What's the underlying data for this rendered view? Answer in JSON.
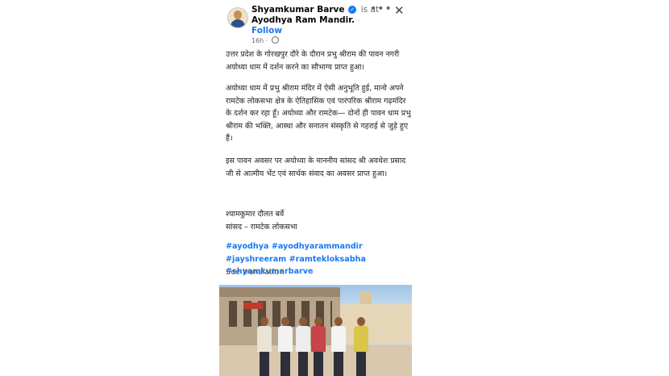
{
  "post": {
    "author": "Shyamkumar Barve",
    "verified_icon": "✓",
    "is_at": "is at",
    "place": "Ayodhya Ram Mandir.",
    "place_dot": "·",
    "follow": "Follow",
    "time": "16h",
    "time_dot": "·",
    "more_icon": "•••",
    "close_icon": "✕",
    "paragraphs": [
      "उत्तर प्रदेश के गोरखपुर दौरे के दौरान प्रभु श्रीराम की पावन नगरी अयोध्या धाम में दर्शन करने का सौभाग्य प्राप्त हुआ।",
      "अयोध्या धाम में प्रभु श्रीराम मंदिर में ऐसी अनुभूति हुई, मानो अपने रामटेक लोकसभा क्षेत्र के ऐतिहासिक एवं पारंपरिक श्रीराम गढ़मंदिर के दर्शन कर रहा हूँ। अयोध्या और रामटेक— दोनों ही पावन धाम प्रभु श्रीराम की भक्ति, आस्था और सनातन संस्कृति से गहराई से जुड़े हुए हैं।",
      "इस पावन अवसर पर अयोध्या के माननीय सांसद श्री अवधेश प्रसाद जी से आत्मीय भेंट एवं सार्थक संवाद का अवसर प्राप्त हुआ।",
      "श्यामकुमार दौलत बर्वे\nसांसद – रामटेक लोकसभा"
    ],
    "hashtags": "#ayodhya #ayodhyarammandir #jayshreeram #ramtekloksabha #shyamkumarbarve",
    "see_translation": "See translation"
  },
  "colors": {
    "link": "#1877f2",
    "secondary_text": "#65676b"
  },
  "photo": {
    "people_shirts": [
      "#e9e4d6",
      "#f2f2f2",
      "#ededed",
      "#c9434a",
      "#f4f4f4",
      "#d9c64a"
    ]
  }
}
